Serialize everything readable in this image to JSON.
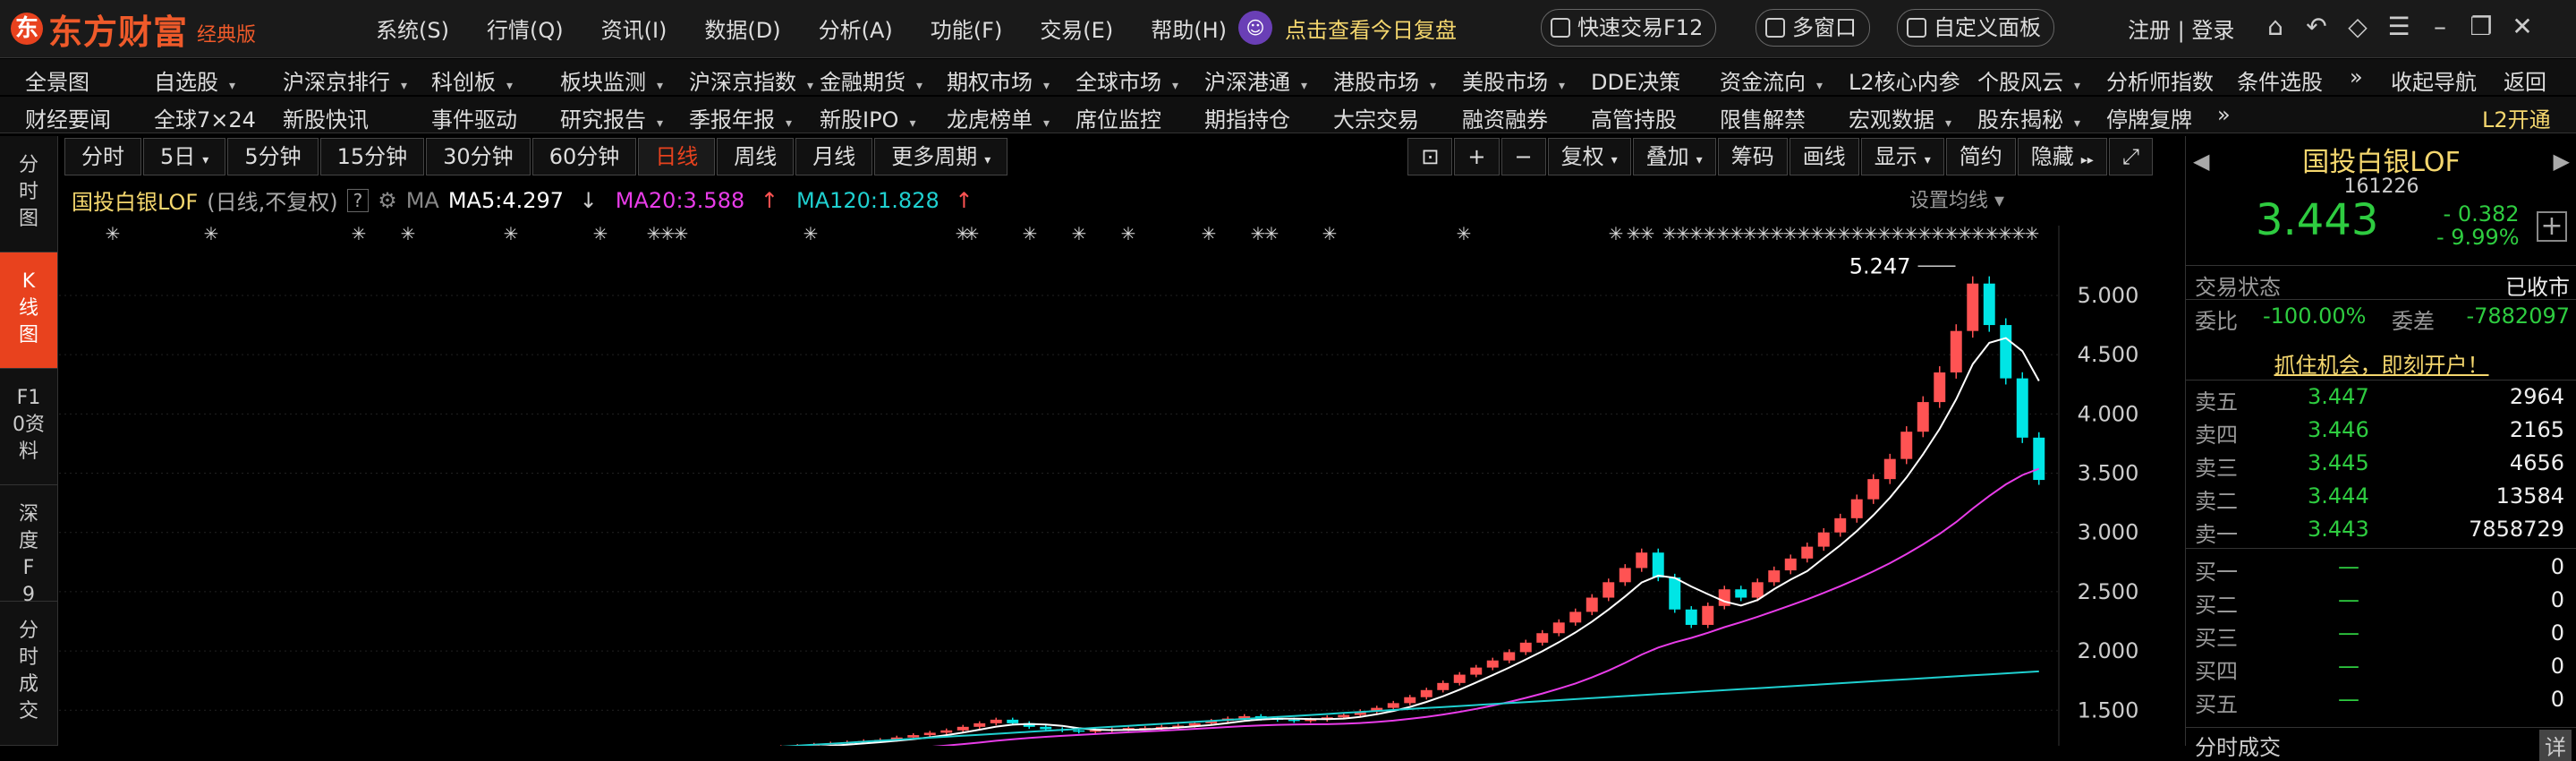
{
  "app": {
    "logo_mark": "东",
    "name": "东方财富",
    "edition": "经典版",
    "menu": [
      "系统(S)",
      "行情(Q)",
      "资讯(I)",
      "数据(D)",
      "分析(A)",
      "功能(F)",
      "交易(E)",
      "帮助(H)"
    ],
    "promo": "点击查看今日复盘",
    "quick_trade": "快速交易F12",
    "multi_window": "多窗口",
    "custom_panel": "自定义面板",
    "login": "注册 | 登录"
  },
  "nav1": [
    "全景图",
    "自选股",
    "沪深京排行",
    "科创板",
    "板块监测",
    "沪深京指数",
    "金融期货",
    "期权市场",
    "全球市场",
    "沪深港通",
    "港股市场",
    "美股市场",
    "DDE决策",
    "资金流向",
    "L2核心内参",
    "个股风云",
    "分析师指数",
    "条件选股",
    "»",
    "收起导航",
    "返回"
  ],
  "nav2": [
    "财经要闻",
    "全球7×24",
    "新股快讯",
    "事件驱动",
    "研究报告",
    "季报年报",
    "新股IPO",
    "龙虎榜单",
    "席位监控",
    "期指持仓",
    "大宗交易",
    "融资融券",
    "高管持股",
    "限售解禁",
    "宏观数据",
    "股东揭秘",
    "停牌复牌",
    "»",
    "L2开通"
  ],
  "left_tabs": [
    "分时图",
    "K线图",
    "F10资料",
    "深度F9",
    "分时成交"
  ],
  "period_tabs": [
    "分时",
    "5日",
    "5分钟",
    "15分钟",
    "30分钟",
    "60分钟",
    "日线",
    "周线",
    "月线",
    "更多周期"
  ],
  "active_period": "日线",
  "tools": [
    "复权",
    "叠加",
    "筹码",
    "画线",
    "显示",
    "简约",
    "隐藏"
  ],
  "legend": {
    "name": "国投白银LOF",
    "mode": "(日线,不复权)",
    "help": "?",
    "ma": "MA",
    "ma5": "MA5:4.297",
    "ma20": "MA20:3.588",
    "ma120": "MA120:1.828",
    "setting": "设置均线"
  },
  "colors": {
    "up": "#ff5353",
    "down": "#00e5e5",
    "ma5": "#ffffff",
    "ma20": "#e83ce8",
    "ma120": "#1fd0d0",
    "accent": "#e8421e"
  },
  "chart_data": {
    "type": "candlestick",
    "ylim": [
      1.2,
      5.4
    ],
    "yticks": [
      1.5,
      2.0,
      2.5,
      3.0,
      3.5,
      4.0,
      4.5,
      5.0
    ],
    "ytick_labels": [
      "1.500",
      "2.000",
      "2.500",
      "3.000",
      "3.500",
      "4.000",
      "4.500",
      "5.000"
    ],
    "max_label": "5.247",
    "max_value": 5.247,
    "close_series": [
      1.0,
      1.0,
      1.01,
      1.01,
      1.02,
      1.02,
      1.02,
      1.03,
      1.03,
      1.04,
      1.04,
      1.04,
      1.05,
      1.05,
      1.06,
      1.06,
      1.07,
      1.07,
      1.07,
      1.08,
      1.08,
      1.09,
      1.09,
      1.1,
      1.11,
      1.11,
      1.12,
      1.12,
      1.13,
      1.13,
      1.14,
      1.15,
      1.16,
      1.17,
      1.18,
      1.19,
      1.2,
      1.21,
      1.22,
      1.23,
      1.24,
      1.25,
      1.27,
      1.29,
      1.31,
      1.33,
      1.36,
      1.39,
      1.42,
      1.39,
      1.36,
      1.34,
      1.33,
      1.32,
      1.33,
      1.34,
      1.35,
      1.35,
      1.36,
      1.37,
      1.39,
      1.41,
      1.43,
      1.45,
      1.43,
      1.42,
      1.41,
      1.42,
      1.44,
      1.46,
      1.49,
      1.52,
      1.56,
      1.61,
      1.67,
      1.73,
      1.8,
      1.86,
      1.92,
      1.99,
      2.07,
      2.15,
      2.24,
      2.33,
      2.45,
      2.58,
      2.7,
      2.83,
      2.62,
      2.35,
      2.22,
      2.38,
      2.52,
      2.45,
      2.58,
      2.68,
      2.78,
      2.88,
      3.0,
      3.12,
      3.28,
      3.45,
      3.62,
      3.85,
      4.1,
      4.35,
      4.7,
      5.1,
      4.75,
      4.3,
      3.8,
      3.443
    ],
    "ma_lines": [
      {
        "name": "MA5",
        "values": [
          4.297
        ]
      },
      {
        "name": "MA20",
        "values": [
          3.588
        ]
      },
      {
        "name": "MA120",
        "values": [
          1.828
        ]
      }
    ]
  },
  "quote": {
    "name": "国投白银LOF",
    "code": "161226",
    "price": "3.443",
    "change": "- 0.382",
    "change_pct": "- 9.99%",
    "status_label": "交易状态",
    "status_value": "已收市",
    "wb_label": "委比",
    "wb_value": "-100.00%",
    "wc_label": "委差",
    "wc_value": "-7882097",
    "ad": "抓住机会，即刻开户！",
    "asks": [
      {
        "label": "卖五",
        "price": "3.447",
        "vol": "2964"
      },
      {
        "label": "卖四",
        "price": "3.446",
        "vol": "2165"
      },
      {
        "label": "卖三",
        "price": "3.445",
        "vol": "4656"
      },
      {
        "label": "卖二",
        "price": "3.444",
        "vol": "13584"
      },
      {
        "label": "卖一",
        "price": "3.443",
        "vol": "7858729"
      }
    ],
    "bids": [
      {
        "label": "买一",
        "price": "—",
        "vol": "0"
      },
      {
        "label": "买二",
        "price": "—",
        "vol": "0"
      },
      {
        "label": "买三",
        "price": "—",
        "vol": "0"
      },
      {
        "label": "买四",
        "price": "—",
        "vol": "0"
      },
      {
        "label": "买五",
        "price": "—",
        "vol": "0"
      }
    ],
    "footer": "分时成交",
    "footer_right": "详"
  }
}
